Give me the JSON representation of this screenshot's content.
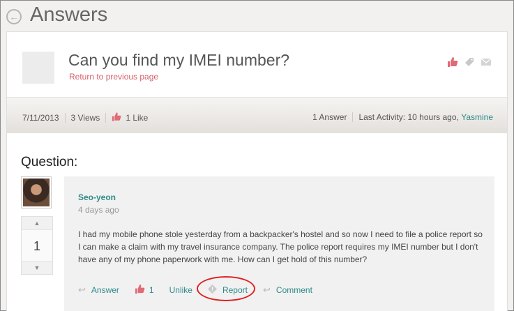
{
  "header": {
    "title": "Answers"
  },
  "question": {
    "title": "Can you find my IMEI number?",
    "return_link": "Return to previous page"
  },
  "meta": {
    "date": "7/11/2013",
    "views": "3 Views",
    "likes": "1 Like",
    "answers": "1 Answer",
    "last_activity": "Last Activity: 10 hours ago,",
    "last_user": "Yasmine"
  },
  "section_label": "Question:",
  "vote": {
    "count": "1"
  },
  "post": {
    "author": "Seo-yeon",
    "time": "4 days ago",
    "body": "I had my mobile phone stole yesterday from a backpacker's hostel and so now I need to file a police report so I can make a claim with my travel insurance company. The police report requires my IMEI number but I don't have any of my phone paperwork with me. How can I get hold of this number?"
  },
  "actions": {
    "answer": "Answer",
    "like_count": "1",
    "unlike": "Unlike",
    "report": "Report",
    "comment": "Comment"
  },
  "colors": {
    "accent": "#2e8b8a",
    "like": "#e06a75",
    "highlight": "#e02020"
  }
}
